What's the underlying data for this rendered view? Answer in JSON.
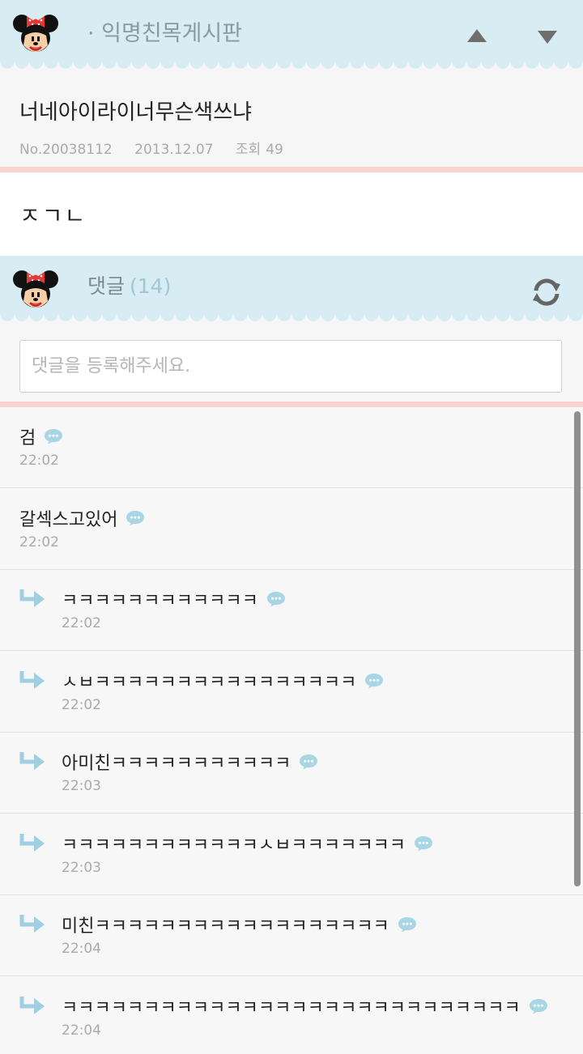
{
  "header": {
    "board_title": "· 익명친목게시판",
    "up_icon": "triangle-up-icon",
    "down_icon": "triangle-down-icon",
    "mascot_icon": "minnie-mouse-icon"
  },
  "post": {
    "title": "너네아이라이너무슨색쓰냐",
    "number": "No.20038112",
    "date": "2013.12.07",
    "views_label": "조회",
    "views": "49",
    "body": "ㅈㄱㄴ"
  },
  "comments_header": {
    "label": "댓글",
    "count": "(14)",
    "refresh_icon": "refresh-icon"
  },
  "comment_input": {
    "placeholder": "댓글을 등록해주세요."
  },
  "comments": [
    {
      "text": "검",
      "time": "22:02",
      "reply": false
    },
    {
      "text": "갈섹스고있어",
      "time": "22:02",
      "reply": false
    },
    {
      "text": "ㅋㅋㅋㅋㅋㅋㅋㅋㅋㅋㅋㅋ",
      "time": "22:02",
      "reply": true
    },
    {
      "text": "ㅅㅂㅋㅋㅋㅋㅋㅋㅋㅋㅋㅋㅋㅋㅋㅋㅋㅋ",
      "time": "22:02",
      "reply": true
    },
    {
      "text": "아미친ㅋㅋㅋㅋㅋㅋㅋㅋㅋㅋㅋ",
      "time": "22:03",
      "reply": true
    },
    {
      "text": "ㅋㅋㅋㅋㅋㅋㅋㅋㅋㅋㅋㅋㅅㅂㅋㅋㅋㅋㅋㅋㅋ",
      "time": "22:03",
      "reply": true
    },
    {
      "text": "미친ㅋㅋㅋㅋㅋㅋㅋㅋㅋㅋㅋㅋㅋㅋㅋㅋㅋㅋ",
      "time": "22:04",
      "reply": true
    },
    {
      "text": "ㅋㅋㅋㅋㅋㅋㅋㅋㅋㅋㅋㅋㅋㅋㅋㅋㅋㅋㅋㅋㅋㅋㅋㅋㅋㅋㅋㅋ",
      "time": "22:04",
      "reply": true
    }
  ],
  "colors": {
    "header_bg": "#d8edf3",
    "divider_pink": "#f9d3cf",
    "bubble_blue": "#a9d6e5",
    "reply_arrow_blue": "#9fcfe1"
  }
}
